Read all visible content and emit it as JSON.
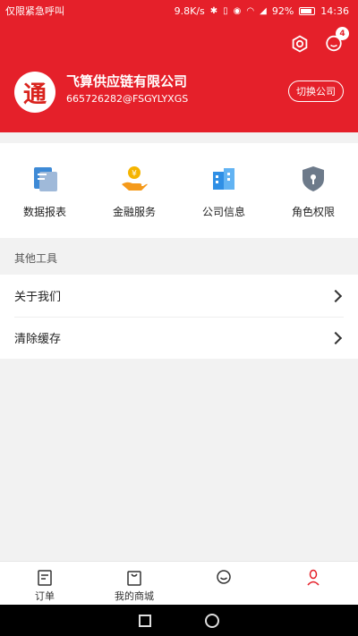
{
  "status_bar": {
    "left_text": "仅限紧急呼叫",
    "speed": "9.8K/s",
    "battery": "92%",
    "time": "14:36"
  },
  "header": {
    "badge_count": "4",
    "logo_char": "通",
    "company_name": "飞算供应链有限公司",
    "company_id": "665726282@FSGYLYXGS",
    "switch_label": "切换公司",
    "accent_color": "#e5202a"
  },
  "grid": [
    {
      "label": "数据报表",
      "icon": "report-icon"
    },
    {
      "label": "金融服务",
      "icon": "finance-icon"
    },
    {
      "label": "公司信息",
      "icon": "company-icon"
    },
    {
      "label": "角色权限",
      "icon": "shield-lock-icon"
    }
  ],
  "tools": {
    "section_title": "其他工具",
    "items": [
      {
        "label": "关于我们"
      },
      {
        "label": "清除缓存"
      }
    ]
  },
  "tabbar": [
    {
      "label": "订单",
      "icon": "order-icon"
    },
    {
      "label": "我的商城",
      "icon": "shop-bag-icon"
    },
    {
      "label": "",
      "icon": "tab-center-icon"
    },
    {
      "label": "",
      "icon": "profile-icon"
    }
  ]
}
